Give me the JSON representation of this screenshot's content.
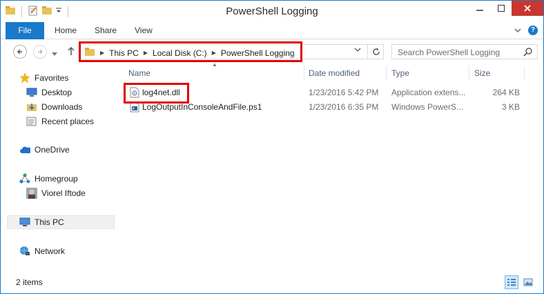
{
  "window": {
    "title": "PowerShell Logging"
  },
  "ribbon": {
    "tabs": [
      "File",
      "Home",
      "Share",
      "View"
    ]
  },
  "address": {
    "crumbs": [
      "This PC",
      "Local Disk (C:)",
      "PowerShell Logging"
    ]
  },
  "search": {
    "placeholder": "Search PowerShell Logging"
  },
  "navpane": {
    "favorites": "Favorites",
    "desktop": "Desktop",
    "downloads": "Downloads",
    "recent": "Recent places",
    "onedrive": "OneDrive",
    "homegroup": "Homegroup",
    "user": "Viorel Iftode",
    "thispc": "This PC",
    "network": "Network"
  },
  "columns": {
    "name": "Name",
    "date": "Date modified",
    "type": "Type",
    "size": "Size"
  },
  "files": [
    {
      "name": "log4net.dll",
      "date": "1/23/2016 5:42 PM",
      "type": "Application extens...",
      "size": "264 KB"
    },
    {
      "name": "LogOutputInConsoleAndFile.ps1",
      "date": "1/23/2016 6:35 PM",
      "type": "Windows PowerS...",
      "size": "3 KB"
    }
  ],
  "status": {
    "count": "2 items"
  },
  "colors": {
    "accent": "#1979ca",
    "close": "#c7372f",
    "highlight": "#e00000"
  }
}
